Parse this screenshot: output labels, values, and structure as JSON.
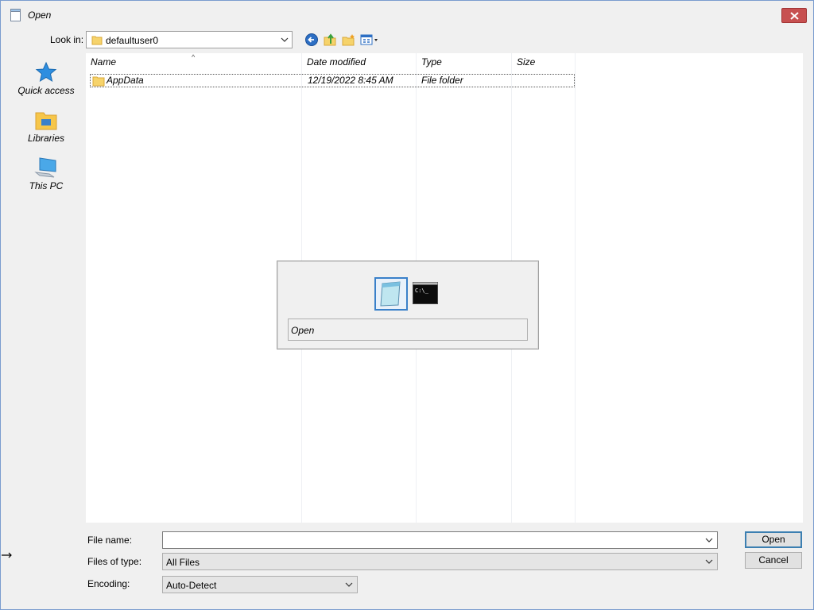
{
  "window": {
    "title": "Open"
  },
  "lookin": {
    "label": "Look in:",
    "value": "defaultuser0"
  },
  "places": [
    {
      "label": "Quick access",
      "icon": "star-icon"
    },
    {
      "label": "Libraries",
      "icon": "libraries-icon"
    },
    {
      "label": "This PC",
      "icon": "computer-icon"
    }
  ],
  "columns": {
    "name": "Name",
    "date": "Date modified",
    "type": "Type",
    "size": "Size"
  },
  "files": [
    {
      "name": "AppData",
      "date": "12/19/2022 8:45 AM",
      "type": "File folder",
      "size": ""
    }
  ],
  "switcher": {
    "label": "Open",
    "apps": [
      "notepad-icon",
      "command-prompt-icon"
    ]
  },
  "form": {
    "filename_label": "File name:",
    "filename_value": "",
    "filetype_label": "Files of type:",
    "filetype_value": "All Files",
    "encoding_label": "Encoding:",
    "encoding_value": "Auto-Detect",
    "open_button": "Open",
    "cancel_button": "Cancel"
  },
  "colors": {
    "close": "#c75050",
    "selection": "#3a80c9",
    "folder": "#f6d36b"
  }
}
